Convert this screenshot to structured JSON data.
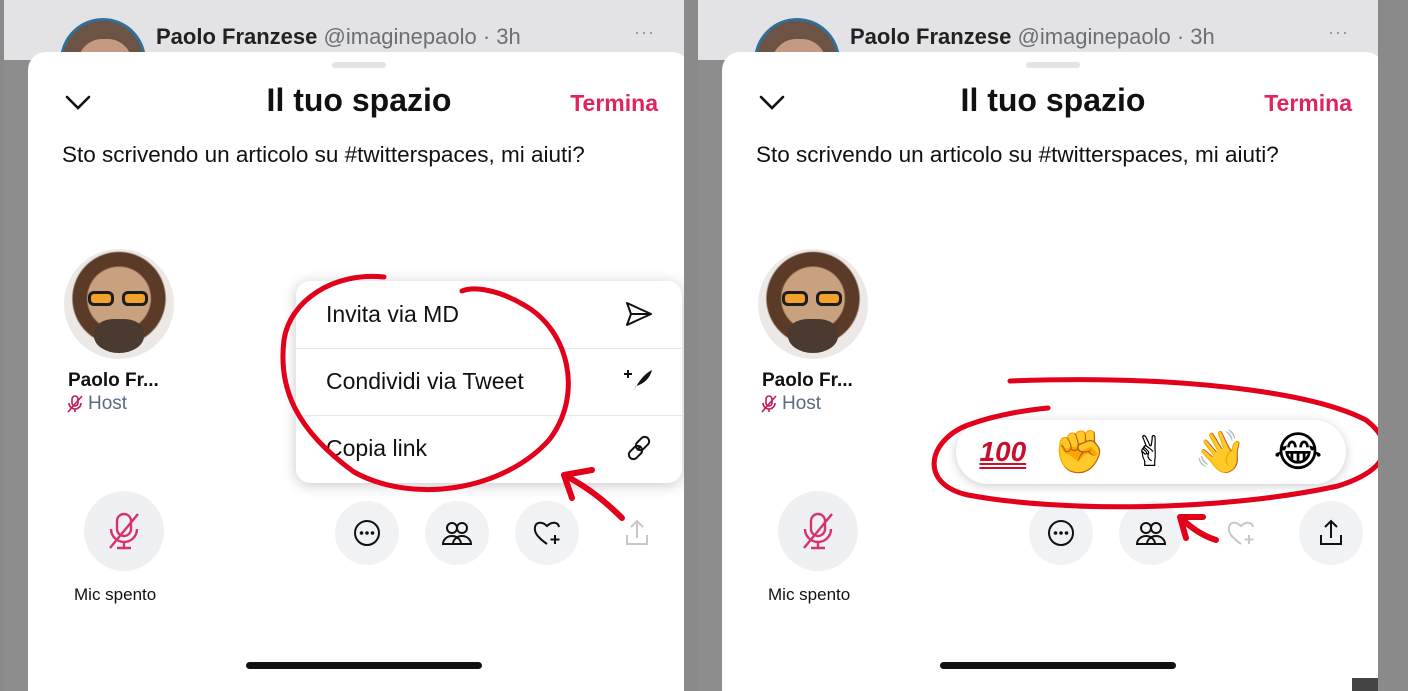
{
  "panels": [
    {
      "tweet": {
        "name": "Paolo Franzese",
        "handle": "@imaginepaolo · 3h",
        "more": "···"
      },
      "sheet": {
        "title": "Il tuo spazio",
        "end_label": "Termina",
        "description": "Sto scrivendo un articolo su #twitterspaces, mi aiuti?"
      },
      "host": {
        "name": "Paolo Fr...",
        "role": "Host"
      },
      "mic": {
        "label": "Mic spento"
      },
      "share_menu": {
        "items": [
          {
            "label": "Invita via MD",
            "icon": "send-icon"
          },
          {
            "label": "Condividi via Tweet",
            "icon": "compose-tweet-icon"
          },
          {
            "label": "Copia link",
            "icon": "link-icon"
          }
        ]
      }
    },
    {
      "tweet": {
        "name": "Paolo Franzese",
        "handle": "@imaginepaolo · 3h",
        "more": "···"
      },
      "sheet": {
        "title": "Il tuo spazio",
        "end_label": "Termina",
        "description": "Sto scrivendo un articolo su #twitterspaces, mi aiuti?"
      },
      "host": {
        "name": "Paolo Fr...",
        "role": "Host"
      },
      "mic": {
        "label": "Mic spento"
      },
      "reactions": [
        "100",
        "✊",
        "✌",
        "👋",
        "😂"
      ]
    }
  ],
  "colors": {
    "accent": "#e0245e",
    "annotation": "#e3001b",
    "background": "#8a8a8a"
  },
  "icons": [
    "chevron-down-icon",
    "mic-off-icon",
    "more-icon",
    "people-icon",
    "heart-add-icon",
    "share-icon"
  ]
}
